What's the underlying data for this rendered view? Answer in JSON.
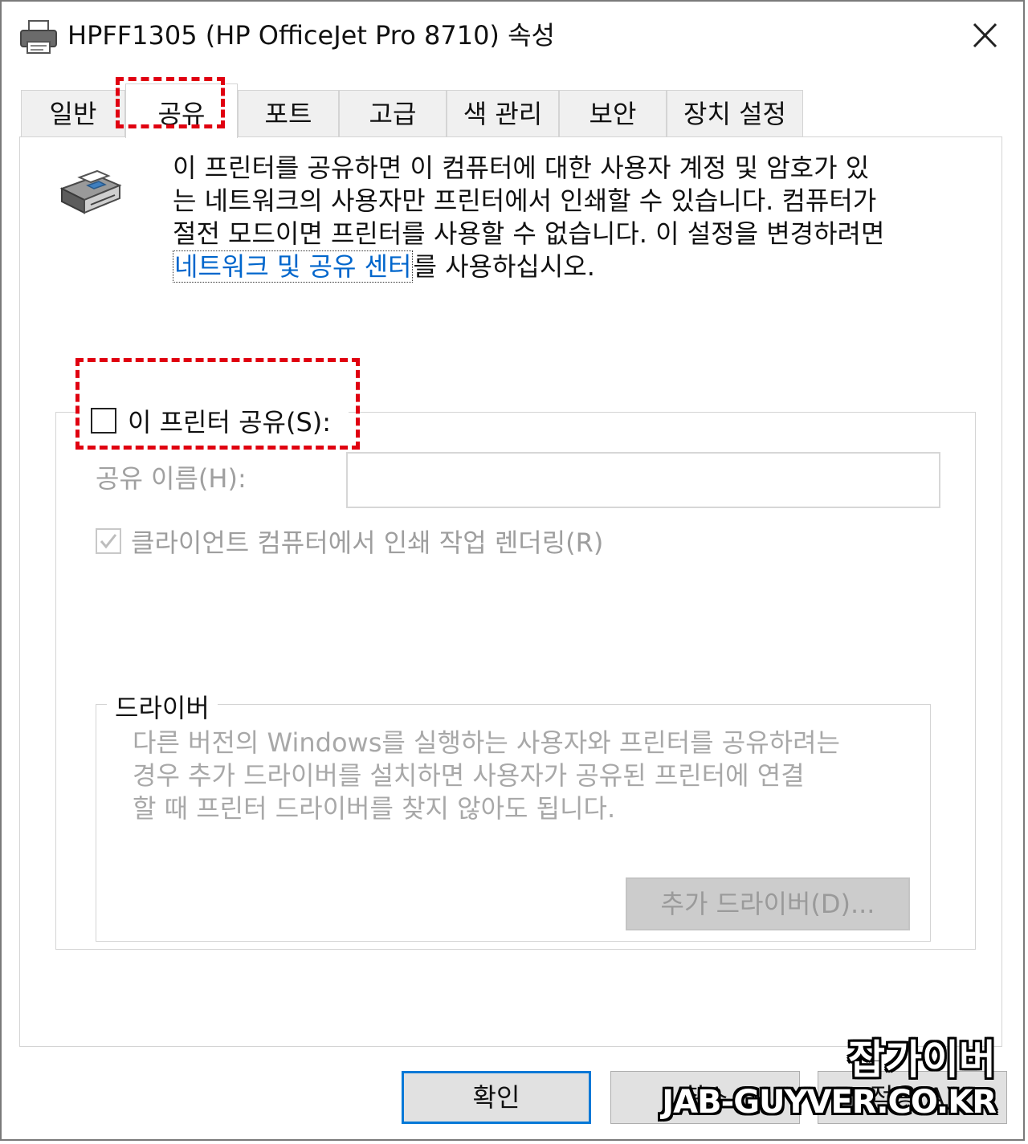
{
  "window": {
    "title": "HPFF1305 (HP OfficeJet Pro 8710) 속성",
    "close_label": "✕"
  },
  "tabs": [
    {
      "label": "일반"
    },
    {
      "label": "공유"
    },
    {
      "label": "포트"
    },
    {
      "label": "고급"
    },
    {
      "label": "색 관리"
    },
    {
      "label": "보안"
    },
    {
      "label": "장치 설정"
    }
  ],
  "sharing": {
    "description_line1": "이 프린터를 공유하면 이 컴퓨터에 대한 사용자 계정 및 암호가 있",
    "description_line2": "는 네트워크의 사용자만 프린터에서 인쇄할 수 있습니다. 컴퓨터가",
    "description_line3": "절전 모드이면 프린터를 사용할 수 없습니다. 이 설정을 변경하려면",
    "link_text": "네트워크 및 공유 센터",
    "description_suffix": "를 사용하십시오.",
    "share_checkbox_label": "이 프린터 공유(S):",
    "share_name_label": "공유 이름(H):",
    "share_name_value": "",
    "render_checkbox_label": "클라이언트 컴퓨터에서 인쇄 작업 렌더링(R)"
  },
  "drivers": {
    "legend": "드라이버",
    "description_line1": "다른 버전의 Windows를 실행하는 사용자와 프린터를 공유하려는",
    "description_line2": "경우 추가 드라이버를 설치하면 사용자가 공유된 프린터에 연결",
    "description_line3": "할 때 프린터 드라이버를 찾지 않아도 됩니다.",
    "add_button_label": "추가 드라이버(D)..."
  },
  "buttons": {
    "ok_label": "확인",
    "cancel_label": "취소",
    "apply_label": "적용(A)"
  },
  "watermark": {
    "line1": "잡가이버",
    "line2": "JAB-GUYVER.CO.KR"
  },
  "colors": {
    "annotation": "#e00010",
    "link": "#0066cc",
    "focus_border": "#0078d7"
  }
}
